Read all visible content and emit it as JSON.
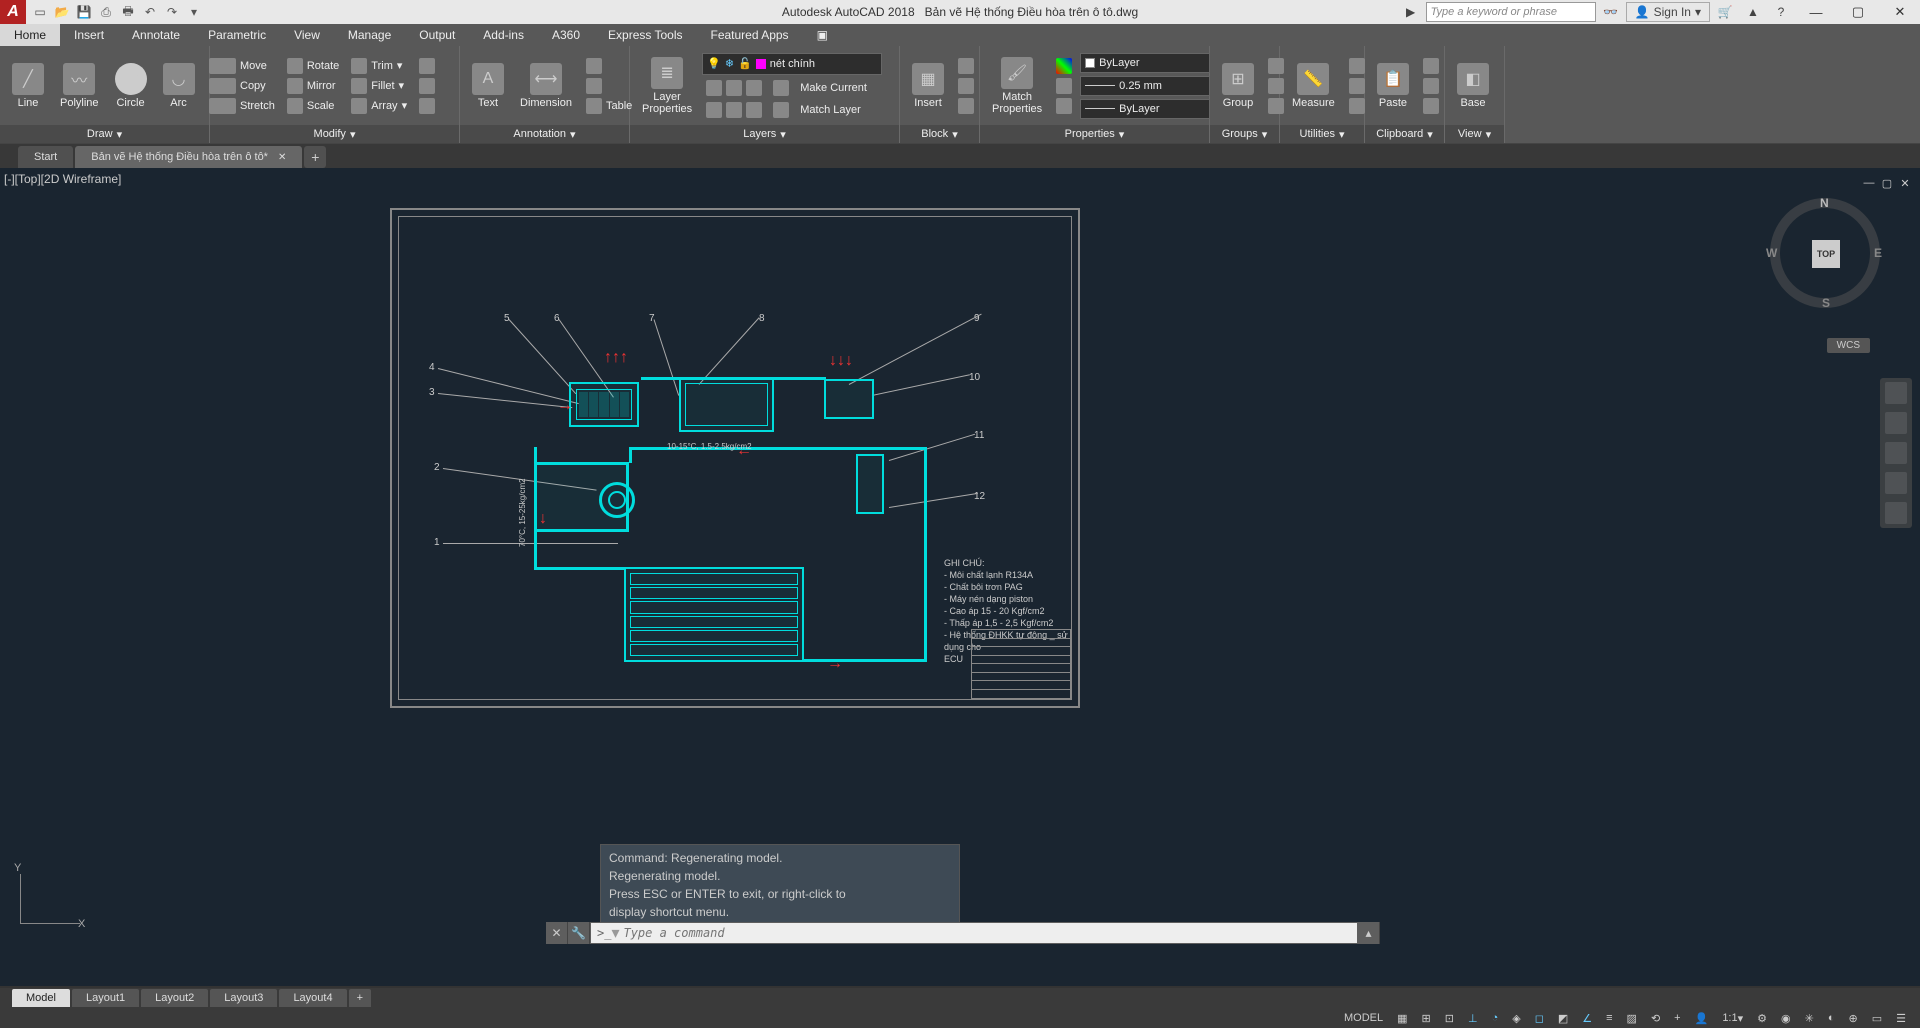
{
  "title": {
    "app": "Autodesk AutoCAD 2018",
    "file": "Bản vẽ Hệ thống Điều hòa trên ô tô.dwg"
  },
  "search": {
    "placeholder": "Type a keyword or phrase"
  },
  "signin": "Sign In",
  "menu": [
    "Home",
    "Insert",
    "Annotate",
    "Parametric",
    "View",
    "Manage",
    "Output",
    "Add-ins",
    "A360",
    "Express Tools",
    "Featured Apps"
  ],
  "ribbon": {
    "draw": {
      "title": "Draw",
      "items": [
        "Line",
        "Polyline",
        "Circle",
        "Arc"
      ]
    },
    "modify": {
      "title": "Modify",
      "row1": [
        "Move",
        "Rotate",
        "Trim"
      ],
      "row2": [
        "Copy",
        "Mirror",
        "Fillet"
      ],
      "row3": [
        "Stretch",
        "Scale",
        "Array"
      ]
    },
    "annotation": {
      "title": "Annotation",
      "items": [
        "Text",
        "Dimension",
        "Table"
      ]
    },
    "layers": {
      "title": "Layers",
      "btn": "Layer\nProperties",
      "current": "nét chính",
      "r1": "Make Current",
      "r2": "Match Layer"
    },
    "block": {
      "title": "Block",
      "btn": "Insert"
    },
    "properties": {
      "title": "Properties",
      "btn": "Match\nProperties",
      "layer": "ByLayer",
      "lw": "0.25 mm",
      "lt": "ByLayer"
    },
    "groups": {
      "title": "Groups",
      "btn": "Group"
    },
    "utilities": {
      "title": "Utilities",
      "btn": "Measure"
    },
    "clipboard": {
      "title": "Clipboard",
      "btn": "Paste"
    },
    "view": {
      "title": "View",
      "btn": "Base"
    }
  },
  "file_tabs": {
    "start": "Start",
    "current": "Bản vẽ Hệ thống Điều hòa trên ô tô*"
  },
  "viewport": {
    "label": "[-][Top][2D Wireframe]"
  },
  "viewcube": {
    "top": "TOP",
    "n": "N",
    "s": "S",
    "e": "E",
    "w": "W",
    "wcs": "WCS"
  },
  "drawing": {
    "callouts": [
      "1",
      "2",
      "3",
      "4",
      "5",
      "6",
      "7",
      "8",
      "9",
      "10",
      "11",
      "12"
    ],
    "temp_label": "70°C, 15-25kg/cm2",
    "mid_label": "10-15°C, 1.5-2.5kg/cm2",
    "ghi_chu_title": "GHI CHÚ:",
    "ghi_chu": [
      "- Môi chất lạnh R134A",
      "- Chất bôi trơn PAG",
      "- Máy nén dạng piston",
      "- Cao áp 15 - 20 Kgf/cm2",
      "- Thấp áp 1,5 - 2,5 Kgf/cm2",
      "- Hệ thống ĐHKK tự động _ sử dụng cho",
      "ECU"
    ]
  },
  "cmd": {
    "h1": "Command: Regenerating model.",
    "h2": "Regenerating model.",
    "h3": "Press ESC or ENTER to exit, or right-click to",
    "h4": "display shortcut menu.",
    "prompt": ">_",
    "placeholder": "Type a command"
  },
  "layout_tabs": [
    "Model",
    "Layout1",
    "Layout2",
    "Layout3",
    "Layout4"
  ],
  "status": {
    "model": "MODEL",
    "scale": "1:1"
  }
}
